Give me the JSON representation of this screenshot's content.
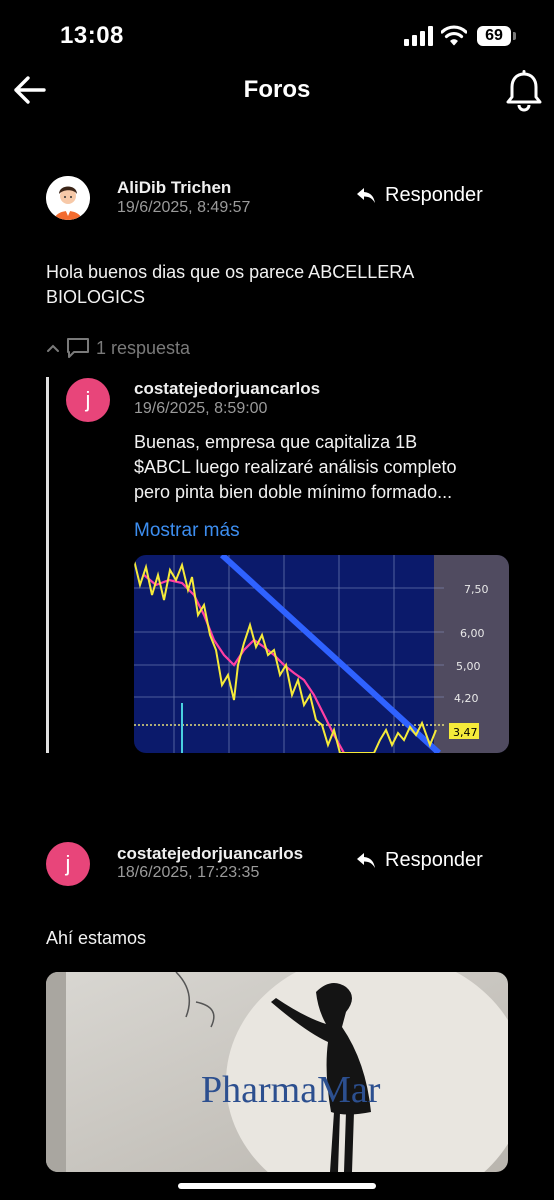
{
  "status": {
    "time": "13:08",
    "battery": "69"
  },
  "header": {
    "title": "Foros"
  },
  "posts": [
    {
      "author": "AliDib Trichen",
      "date": "19/6/2025, 8:49:57",
      "reply_label": "Responder",
      "text_lines": [
        "Hola buenos dias que os parece ABCELLERA",
        "BIOLOGICS"
      ],
      "replies_toggle": "1 respuesta",
      "replies": [
        {
          "avatar_letter": "j",
          "author": "costatejedorjuancarlos",
          "date": "19/6/2025, 8:59:00",
          "text_lines": [
            "Buenas, empresa que capitaliza 1B",
            "$ABCL luego realizaré análisis completo",
            "pero pinta bien doble mínimo formado..."
          ],
          "more_label": "Mostrar más",
          "chart_labels": [
            "7,50",
            "6,00",
            "5,00",
            "4,20",
            "3,47"
          ]
        }
      ]
    },
    {
      "avatar_letter": "j",
      "author": "costatejedorjuancarlos",
      "date": "18/6/2025, 17:23:35",
      "reply_label": "Responder",
      "text": "Ahí estamos",
      "image_text": "PharmaMar"
    }
  ],
  "colors": {
    "accent_link": "#3d8ef0",
    "avatar_pink": "#e8457a",
    "background": "#000000"
  }
}
